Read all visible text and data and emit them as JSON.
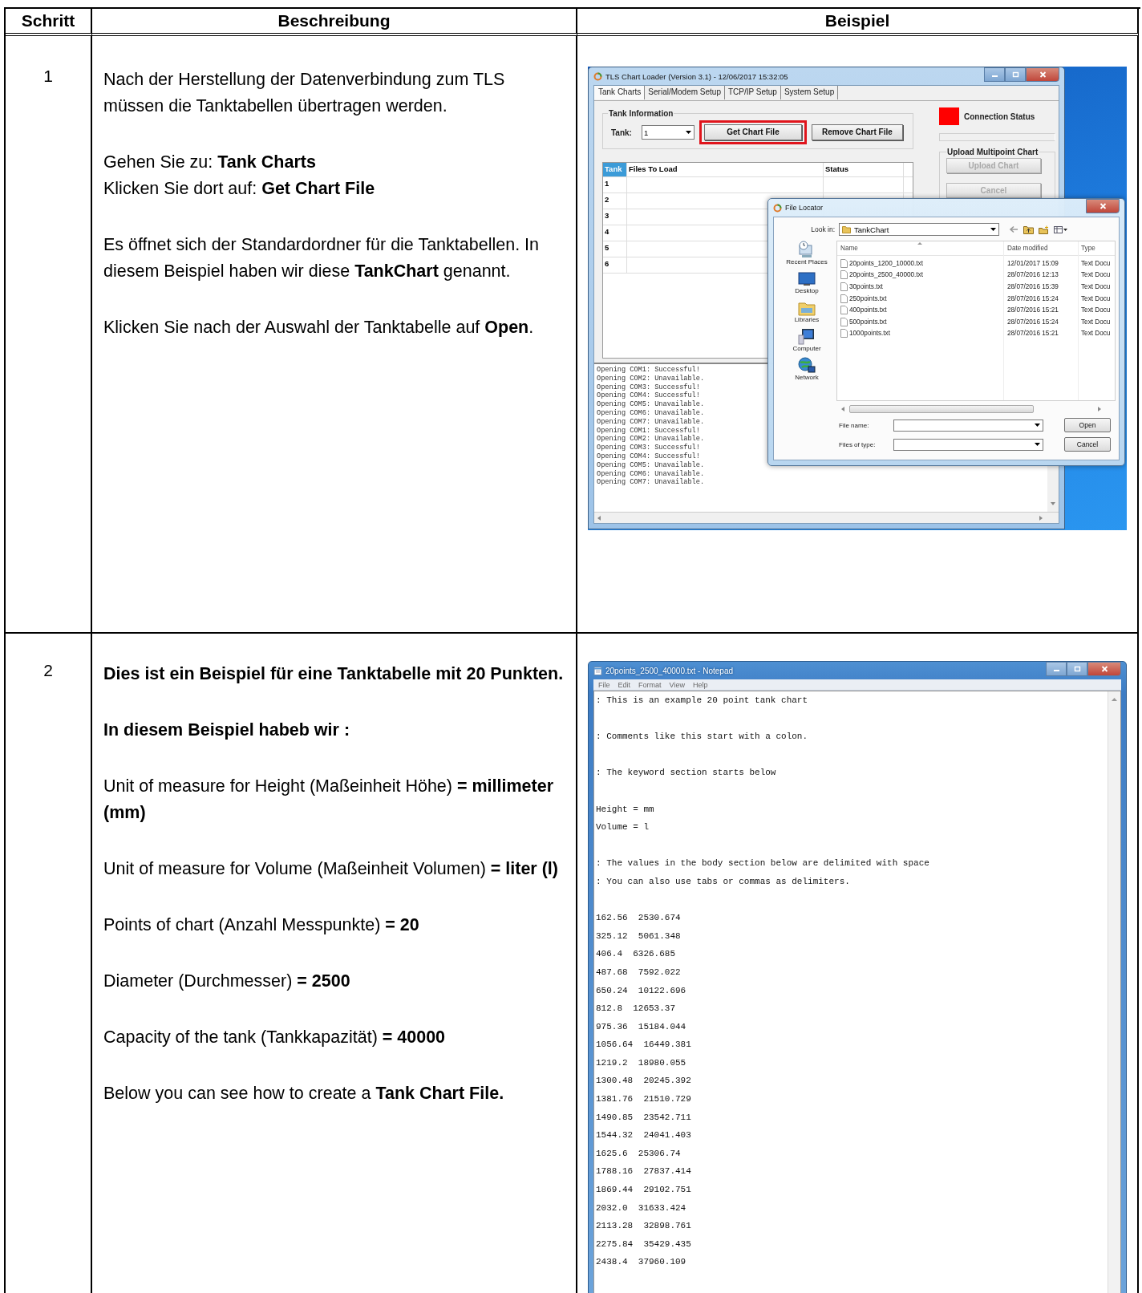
{
  "table": {
    "columns": [
      "Schritt",
      "Beschreibung",
      "Beispiel"
    ],
    "rows": [
      {
        "step": "1",
        "description": [
          [
            {
              "text": "Nach der Herstellung der Datenverbindung zum TLS müssen die Tanktabellen übertragen werden.",
              "bold": false
            }
          ],
          [
            {
              "text": "Gehen Sie zu:  **Tank Charts**",
              "bold": false
            },
            {
              "text": "Klicken Sie dort auf: **Get Chart File**",
              "bold": false
            }
          ],
          [
            {
              "text": "Es öffnet sich der Standardordner für die Tanktabellen. In diesem Beispiel haben wir diese **TankChart** genannt.",
              "bold": false
            }
          ],
          [
            {
              "text": "Klicken Sie nach der Auswahl der Tanktabelle auf **Open**.",
              "bold": false
            }
          ]
        ],
        "example": {
          "kind": "chart_loader",
          "main_window": {
            "title": "TLS Chart Loader (Version 3.1) - 12/06/2017 15:32:05",
            "tabs": [
              {
                "label": "Tank Charts",
                "selected": true
              },
              {
                "label": "Serial/Modem Setup",
                "selected": false
              },
              {
                "label": "TCP/IP Setup",
                "selected": false
              },
              {
                "label": "System Setup",
                "selected": false
              }
            ],
            "tank_information": {
              "title": "Tank Information",
              "tank_label": "Tank:",
              "tank_value": "1"
            },
            "buttons": [
              {
                "label": "Get Chart File",
                "highlighted": true
              },
              {
                "label": "Remove Chart File",
                "highlighted": false
              }
            ],
            "connection": {
              "label": "Connection Status",
              "connected": false,
              "level": 0
            },
            "upload": {
              "title": "Upload Multipoint Chart",
              "buttons": [
                {
                  "label": "Upload Chart",
                  "disabled": true
                },
                {
                  "label": "Cancel",
                  "disabled": true
                }
              ]
            },
            "grid": {
              "columns": [
                {
                  "label": "Tank",
                  "selected": true
                },
                {
                  "label": "Files To Load",
                  "selected": false
                },
                {
                  "label": "Status",
                  "selected": false
                }
              ],
              "rows": [
                "1",
                "2",
                "3",
                "4",
                "5",
                "6"
              ]
            },
            "log": [
              "Opening COM1: Successful!",
              "Opening COM2: Unavailable.",
              "Opening COM3: Successful!",
              "Opening COM4: Successful!",
              "Opening COM5: Unavailable.",
              "Opening COM6: Unavailable.",
              "Opening COM7: Unavailable.",
              "Opening COM1: Successful!",
              "Opening COM2: Unavailable.",
              "Opening COM3: Successful!",
              "Opening COM4: Successful!",
              "Opening COM5: Unavailable.",
              "Opening COM6: Unavailable.",
              "Opening COM7: Unavailable."
            ]
          },
          "file_locator": {
            "title": "File Locator",
            "look_in_label": "Look in:",
            "look_in_value": "TankChart",
            "places": [
              "Recent Places",
              "Desktop",
              "Libraries",
              "Computer",
              "Network"
            ],
            "columns": [
              "Name",
              "Date modified",
              "Type"
            ],
            "files": [
              {
                "name": "20points_1200_10000.txt",
                "date": "12/01/2017 15:09",
                "type": "Text Docu"
              },
              {
                "name": "20points_2500_40000.txt",
                "date": "28/07/2016 12:13",
                "type": "Text Docu"
              },
              {
                "name": "30points.txt",
                "date": "28/07/2016 15:39",
                "type": "Text Docu"
              },
              {
                "name": "250points.txt",
                "date": "28/07/2016 15:24",
                "type": "Text Docu"
              },
              {
                "name": "400points.txt",
                "date": "28/07/2016 15:21",
                "type": "Text Docu"
              },
              {
                "name": "500points.txt",
                "date": "28/07/2016 15:24",
                "type": "Text Docu"
              },
              {
                "name": "1000points.txt",
                "date": "28/07/2016 15:21",
                "type": "Text Docu"
              }
            ],
            "file_name_label": "File name:",
            "files_of_type_label": "Files of type:",
            "buttons": [
              "Open",
              "Cancel"
            ]
          }
        }
      },
      {
        "step": "2",
        "description": [
          [
            {
              "text": "Dies ist ein Beispiel für eine Tanktabelle mit 20 Punkten.",
              "bold": true
            }
          ],
          [
            {
              "text": "In diesem Beispiel habeb wir :",
              "bold": true
            }
          ],
          [
            {
              "text": "Unit of measure for Height (Maßeinheit Höhe) **= millimeter (mm)**",
              "bold": false
            }
          ],
          [
            {
              "text": "Unit of measure for Volume (Maßeinheit Volumen) **= liter (l)**",
              "bold": false
            }
          ],
          [
            {
              "text": "Points of chart (Anzahl Messpunkte) **= 20**",
              "bold": false
            }
          ],
          [
            {
              "text": "Diameter (Durchmesser) **= 2500**",
              "bold": false
            }
          ],
          [
            {
              "text": "Capacity of the tank (Tankkapazität) **= 40000**",
              "bold": false
            }
          ],
          [
            {
              "text": "Below you can see how to create a **Tank Chart File.**",
              "bold": false
            }
          ]
        ],
        "example": {
          "kind": "notepad",
          "title": "20points_2500_40000.txt - Notepad",
          "menu": [
            "File",
            "Edit",
            "Format",
            "View",
            "Help"
          ],
          "blocks": [
            [
              ": This is an example 20 point tank chart"
            ],
            [
              ": Comments like this start with a colon."
            ],
            [
              ": The keyword section starts below"
            ],
            [
              "Height = mm",
              "Volume = l"
            ],
            [
              ": The values in the body section below are delimited with space",
              ": You can also use tabs or commas as delimiters."
            ],
            [
              "162.56  2530.674",
              "325.12  5061.348",
              "406.4  6326.685",
              "487.68  7592.022",
              "650.24  10122.696",
              "812.8  12653.37",
              "975.36  15184.044",
              "1056.64  16449.381",
              "1219.2  18980.055",
              "1300.48  20245.392",
              "1381.76  21510.729",
              "1490.85  23542.711",
              "1544.32  24041.403",
              "1625.6  25306.74",
              "1788.16  27837.414",
              "1869.44  29102.751",
              "2032.0  31633.424",
              "2113.28  32898.761",
              "2275.84  35429.435",
              "2438.4  37960.109"
            ]
          ]
        }
      }
    ]
  }
}
